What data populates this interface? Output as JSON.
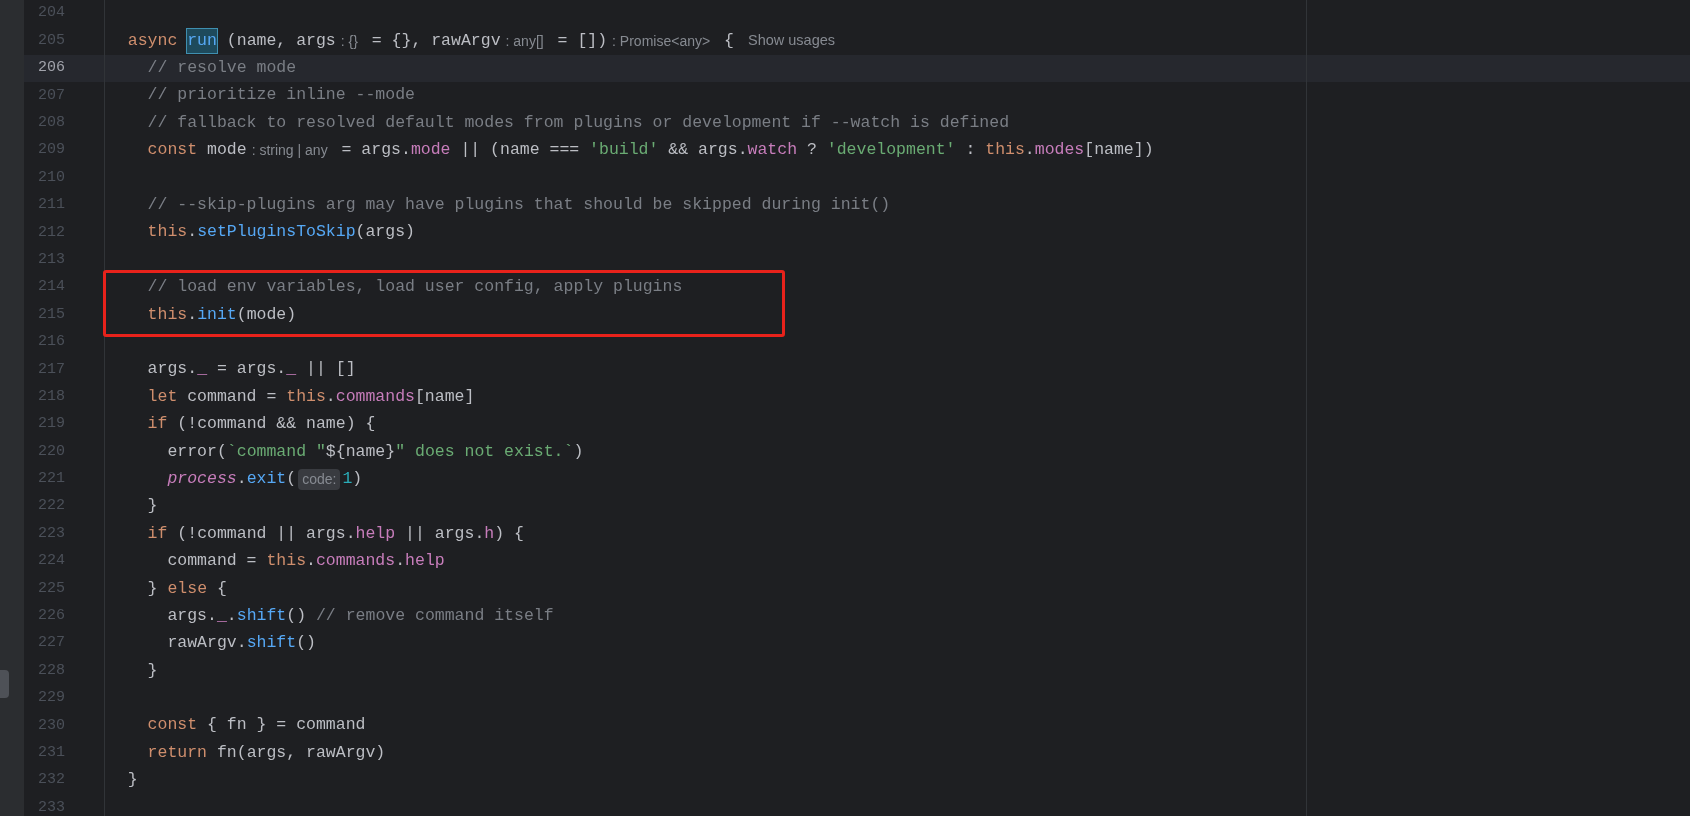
{
  "editor": {
    "lines": [
      {
        "number": "204",
        "current": false,
        "boxed": false
      },
      {
        "number": "205",
        "current": false,
        "boxed": false,
        "tokens": [
          {
            "kind": "keyword",
            "text": "  async "
          },
          {
            "kind": "selected",
            "text": "run"
          },
          {
            "kind": "plain",
            "text": " (name, args"
          },
          {
            "kind": "hint",
            "text": ": {}"
          },
          {
            "kind": "plain",
            "text": " = {}, rawArgv"
          },
          {
            "kind": "hint",
            "text": ": any[]"
          },
          {
            "kind": "plain",
            "text": " = [])"
          },
          {
            "kind": "hint",
            "text": ": Promise<any>"
          },
          {
            "kind": "plain",
            "text": " {"
          },
          {
            "kind": "usages",
            "text": "Show usages"
          }
        ]
      },
      {
        "number": "206",
        "current": true,
        "boxed": false,
        "tokens": [
          {
            "kind": "comment",
            "text": "    // resolve mode"
          }
        ]
      },
      {
        "number": "207",
        "current": false,
        "boxed": false,
        "tokens": [
          {
            "kind": "comment",
            "text": "    // prioritize inline --mode"
          }
        ]
      },
      {
        "number": "208",
        "current": false,
        "boxed": false,
        "tokens": [
          {
            "kind": "comment",
            "text": "    // fallback to resolved default modes from plugins or development if --watch is defined"
          }
        ]
      },
      {
        "number": "209",
        "current": false,
        "boxed": false,
        "tokens": [
          {
            "kind": "keyword",
            "text": "    const"
          },
          {
            "kind": "plain",
            "text": " mode"
          },
          {
            "kind": "hint",
            "text": ": string | any"
          },
          {
            "kind": "plain",
            "text": " = args."
          },
          {
            "kind": "property",
            "text": "mode"
          },
          {
            "kind": "plain",
            "text": " || (name === "
          },
          {
            "kind": "string",
            "text": "'build'"
          },
          {
            "kind": "plain",
            "text": " && args."
          },
          {
            "kind": "property",
            "text": "watch"
          },
          {
            "kind": "plain",
            "text": " ? "
          },
          {
            "kind": "string",
            "text": "'development'"
          },
          {
            "kind": "plain",
            "text": " : "
          },
          {
            "kind": "keyword",
            "text": "this"
          },
          {
            "kind": "plain",
            "text": "."
          },
          {
            "kind": "property",
            "text": "modes"
          },
          {
            "kind": "plain",
            "text": "[name])"
          }
        ]
      },
      {
        "number": "210",
        "current": false,
        "boxed": false
      },
      {
        "number": "211",
        "current": false,
        "boxed": false,
        "tokens": [
          {
            "kind": "comment",
            "text": "    // --skip-plugins arg may have plugins that should be skipped during init()"
          }
        ]
      },
      {
        "number": "212",
        "current": false,
        "boxed": false,
        "tokens": [
          {
            "kind": "keyword",
            "text": "    this"
          },
          {
            "kind": "plain",
            "text": "."
          },
          {
            "kind": "function",
            "text": "setPluginsToSkip"
          },
          {
            "kind": "plain",
            "text": "(args)"
          }
        ]
      },
      {
        "number": "213",
        "current": false,
        "boxed": false
      },
      {
        "number": "214",
        "current": false,
        "boxed": true,
        "tokens": [
          {
            "kind": "comment",
            "text": "    // load env variables, load user config, apply plugins"
          }
        ]
      },
      {
        "number": "215",
        "current": false,
        "boxed": true,
        "tokens": [
          {
            "kind": "keyword",
            "text": "    this"
          },
          {
            "kind": "plain",
            "text": "."
          },
          {
            "kind": "function",
            "text": "init"
          },
          {
            "kind": "plain",
            "text": "(mode)"
          }
        ]
      },
      {
        "number": "216",
        "current": false,
        "boxed": false
      },
      {
        "number": "217",
        "current": false,
        "boxed": false,
        "tokens": [
          {
            "kind": "plain",
            "text": "    args."
          },
          {
            "kind": "property",
            "text": "_"
          },
          {
            "kind": "plain",
            "text": " = args."
          },
          {
            "kind": "property",
            "text": "_"
          },
          {
            "kind": "plain",
            "text": " || []"
          }
        ]
      },
      {
        "number": "218",
        "current": false,
        "boxed": false,
        "tokens": [
          {
            "kind": "keyword",
            "text": "    let"
          },
          {
            "kind": "plain",
            "text": " command = "
          },
          {
            "kind": "keyword",
            "text": "this"
          },
          {
            "kind": "plain",
            "text": "."
          },
          {
            "kind": "property",
            "text": "commands"
          },
          {
            "kind": "plain",
            "text": "[name]"
          }
        ]
      },
      {
        "number": "219",
        "current": false,
        "boxed": false,
        "tokens": [
          {
            "kind": "keyword",
            "text": "    if"
          },
          {
            "kind": "plain",
            "text": " (!command && name) {"
          }
        ]
      },
      {
        "number": "220",
        "current": false,
        "boxed": false,
        "tokens": [
          {
            "kind": "plain",
            "text": "      error("
          },
          {
            "kind": "string",
            "text": "`command \""
          },
          {
            "kind": "plain",
            "text": "${name}"
          },
          {
            "kind": "string",
            "text": "\" does not exist.`"
          },
          {
            "kind": "plain",
            "text": ")"
          }
        ]
      },
      {
        "number": "221",
        "current": false,
        "boxed": false,
        "tokens": [
          {
            "kind": "global",
            "text": "      process"
          },
          {
            "kind": "plain",
            "text": "."
          },
          {
            "kind": "function",
            "text": "exit"
          },
          {
            "kind": "plain",
            "text": "("
          },
          {
            "kind": "param-hint",
            "text": "code:"
          },
          {
            "kind": "number",
            "text": "1"
          },
          {
            "kind": "plain",
            "text": ")"
          }
        ]
      },
      {
        "number": "222",
        "current": false,
        "boxed": false,
        "tokens": [
          {
            "kind": "plain",
            "text": "    }"
          }
        ]
      },
      {
        "number": "223",
        "current": false,
        "boxed": false,
        "tokens": [
          {
            "kind": "keyword",
            "text": "    if"
          },
          {
            "kind": "plain",
            "text": " (!command || args."
          },
          {
            "kind": "property",
            "text": "help"
          },
          {
            "kind": "plain",
            "text": " || args."
          },
          {
            "kind": "property",
            "text": "h"
          },
          {
            "kind": "plain",
            "text": ") {"
          }
        ]
      },
      {
        "number": "224",
        "current": false,
        "boxed": false,
        "tokens": [
          {
            "kind": "plain",
            "text": "      command = "
          },
          {
            "kind": "keyword",
            "text": "this"
          },
          {
            "kind": "plain",
            "text": "."
          },
          {
            "kind": "property",
            "text": "commands"
          },
          {
            "kind": "plain",
            "text": "."
          },
          {
            "kind": "property",
            "text": "help"
          }
        ]
      },
      {
        "number": "225",
        "current": false,
        "boxed": false,
        "tokens": [
          {
            "kind": "plain",
            "text": "    } "
          },
          {
            "kind": "keyword",
            "text": "else"
          },
          {
            "kind": "plain",
            "text": " {"
          }
        ]
      },
      {
        "number": "226",
        "current": false,
        "boxed": false,
        "tokens": [
          {
            "kind": "plain",
            "text": "      args."
          },
          {
            "kind": "property",
            "text": "_"
          },
          {
            "kind": "plain",
            "text": "."
          },
          {
            "kind": "function",
            "text": "shift"
          },
          {
            "kind": "plain",
            "text": "() "
          },
          {
            "kind": "comment",
            "text": "// remove command itself"
          }
        ]
      },
      {
        "number": "227",
        "current": false,
        "boxed": false,
        "tokens": [
          {
            "kind": "plain",
            "text": "      rawArgv."
          },
          {
            "kind": "function",
            "text": "shift"
          },
          {
            "kind": "plain",
            "text": "()"
          }
        ]
      },
      {
        "number": "228",
        "current": false,
        "boxed": false,
        "tokens": [
          {
            "kind": "plain",
            "text": "    }"
          }
        ]
      },
      {
        "number": "229",
        "current": false,
        "boxed": false
      },
      {
        "number": "230",
        "current": false,
        "boxed": false,
        "tokens": [
          {
            "kind": "keyword",
            "text": "    const"
          },
          {
            "kind": "plain",
            "text": " { fn } = command"
          }
        ]
      },
      {
        "number": "231",
        "current": false,
        "boxed": false,
        "tokens": [
          {
            "kind": "keyword",
            "text": "    return"
          },
          {
            "kind": "plain",
            "text": " fn(args, rawArgv)"
          }
        ]
      },
      {
        "number": "232",
        "current": false,
        "boxed": false,
        "tokens": [
          {
            "kind": "plain",
            "text": "  }"
          }
        ]
      },
      {
        "number": "233",
        "current": false,
        "boxed": false
      }
    ]
  }
}
